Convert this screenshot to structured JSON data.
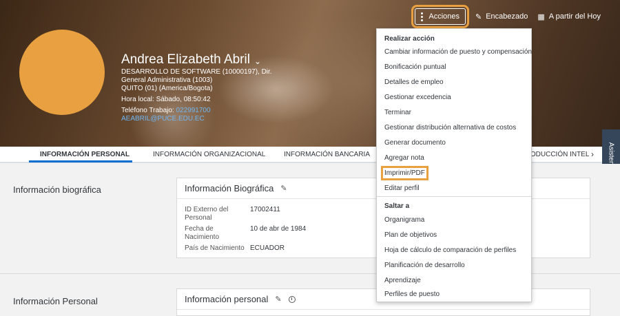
{
  "header": {
    "name": "Andrea Elizabeth Abril",
    "dept_line1": "DESARROLLO DE SOFTWARE (10000197), Dir.",
    "dept_line2": "General Administrativa (1003)",
    "location": "QUITO (01) (America/Bogota)",
    "local_time": "Hora local: Sábado, 08:50:42",
    "phone_label": "Teléfono Trabajo:",
    "phone_value": "022991700",
    "email": "AEABRIL@PUCE.EDU.EC",
    "actions_label": "Acciones",
    "header_label": "Encabezado",
    "from_today_label": "A partir del Hoy"
  },
  "tabs": [
    "INFORMACIÓN PERSONAL",
    "INFORMACIÓN ORGANIZACIONAL",
    "INFORMACIÓN BANCARIA",
    "PRODUCCIÓN INTEL"
  ],
  "assist_label": "Asistencia",
  "sections": {
    "bio_title": "Información biográfica",
    "bio_card_title": "Información Biográfica",
    "fields": [
      {
        "label": "ID Externo del Personal",
        "value": "17002411"
      },
      {
        "label": "Fecha de Nacimiento",
        "value": "10 de abr de 1984"
      },
      {
        "label": "País de Nacimiento",
        "value": "ECUADOR"
      }
    ],
    "personal_title": "Información Personal",
    "personal_card_title": "Información personal"
  },
  "menu": {
    "group1": "Realizar acción",
    "items1": [
      "Cambiar información de puesto y compensación",
      "Bonificación puntual",
      "Detalles de empleo",
      "Gestionar excedencia",
      "Terminar",
      "Gestionar distribución alternativa de costos",
      "Generar documento",
      "Agregar nota",
      "Imprimir/PDF",
      "Editar perfil"
    ],
    "group2": "Saltar a",
    "items2": [
      "Organigrama",
      "Plan de objetivos",
      "Hoja de cálculo de comparación de perfiles",
      "Planificación de desarrollo",
      "Aprendizaje",
      "Perfiles de puesto"
    ]
  }
}
